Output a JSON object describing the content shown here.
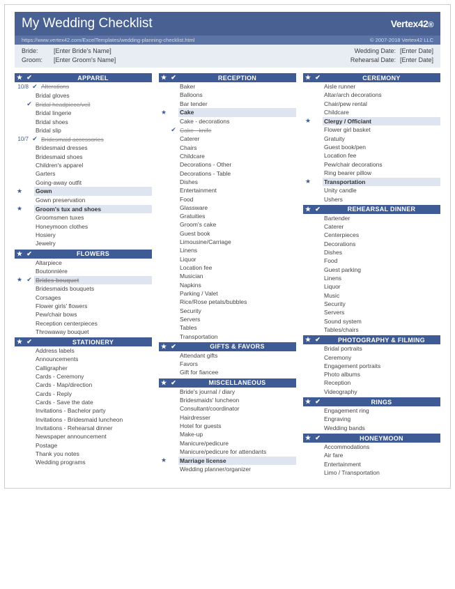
{
  "header": {
    "title": "My Wedding Checklist",
    "logo": "Vertex42",
    "url": "https://www.vertex42.com/ExcelTemplates/wedding-planning-checklist.html",
    "copyright": "© 2007-2018 Vertex42 LLC"
  },
  "info": {
    "bride_label": "Bride:",
    "bride_value": "[Enter Bride's Name]",
    "groom_label": "Groom:",
    "groom_value": "[Enter Groom's Name]",
    "wedding_label": "Wedding Date:",
    "wedding_value": "[Enter Date]",
    "rehearsal_label": "Rehearsal Date:",
    "rehearsal_value": "[Enter Date]"
  },
  "columns": [
    {
      "sections": [
        {
          "title": "APPAREL",
          "items": [
            {
              "label": "Alterations",
              "date": "10/8",
              "checked": true
            },
            {
              "label": "Bridal gloves"
            },
            {
              "label": "Bridal headpiece/veil",
              "checked": true
            },
            {
              "label": "Bridal lingerie"
            },
            {
              "label": "Bridal shoes"
            },
            {
              "label": "Bridal slip"
            },
            {
              "label": "Bridesmaid accessories",
              "date": "10/7",
              "checked": true
            },
            {
              "label": "Bridesmaid dresses"
            },
            {
              "label": "Bridesmaid shoes"
            },
            {
              "label": "Children's apparel"
            },
            {
              "label": "Garters"
            },
            {
              "label": "Going-away outfit"
            },
            {
              "label": "Gown",
              "starred": true
            },
            {
              "label": "Gown preservation"
            },
            {
              "label": "Groom's tux and shoes",
              "starred": true
            },
            {
              "label": "Groomsmen tuxes"
            },
            {
              "label": "Honeymoon clothes"
            },
            {
              "label": "Hosiery"
            },
            {
              "label": "Jewelry"
            }
          ]
        },
        {
          "title": "FLOWERS",
          "items": [
            {
              "label": "Altarpiece"
            },
            {
              "label": "Boutonnière"
            },
            {
              "label": "Brides bouquet",
              "starred": true,
              "checked": true
            },
            {
              "label": "Bridesmaids bouquets"
            },
            {
              "label": "Corsages"
            },
            {
              "label": "Flower girls' flowers"
            },
            {
              "label": "Pew/chair bows"
            },
            {
              "label": "Reception centerpieces"
            },
            {
              "label": "Throwaway bouquet"
            }
          ]
        },
        {
          "title": "STATIONERY",
          "items": [
            {
              "label": "Address labels"
            },
            {
              "label": "Announcements"
            },
            {
              "label": "Calligrapher"
            },
            {
              "label": "Cards - Ceremony"
            },
            {
              "label": "Cards - Map/direction"
            },
            {
              "label": "Cards - Reply"
            },
            {
              "label": "Cards - Save the date"
            },
            {
              "label": "Invitations - Bachelor party"
            },
            {
              "label": "Invitations - Bridesmaid luncheon"
            },
            {
              "label": "Invitations - Rehearsal dinner"
            },
            {
              "label": "Newspaper announcement"
            },
            {
              "label": "Postage"
            },
            {
              "label": "Thank you notes"
            },
            {
              "label": "Wedding programs"
            }
          ]
        }
      ]
    },
    {
      "sections": [
        {
          "title": "RECEPTION",
          "items": [
            {
              "label": "Baker"
            },
            {
              "label": "Balloons"
            },
            {
              "label": "Bar tender"
            },
            {
              "label": "Cake",
              "starred": true
            },
            {
              "label": "Cake - decorations"
            },
            {
              "label": "Cake - knife",
              "checked": true
            },
            {
              "label": "Caterer"
            },
            {
              "label": "Chairs"
            },
            {
              "label": "Childcare"
            },
            {
              "label": "Decorations - Other"
            },
            {
              "label": "Decorations - Table"
            },
            {
              "label": "Dishes"
            },
            {
              "label": "Entertainment"
            },
            {
              "label": "Food"
            },
            {
              "label": "Glassware"
            },
            {
              "label": "Gratuities"
            },
            {
              "label": "Groom's cake"
            },
            {
              "label": "Guest book"
            },
            {
              "label": "Limousine/Carriage"
            },
            {
              "label": "Linens"
            },
            {
              "label": "Liquor"
            },
            {
              "label": "Location fee"
            },
            {
              "label": "Musician"
            },
            {
              "label": "Napkins"
            },
            {
              "label": "Parking / Valet"
            },
            {
              "label": "Rice/Rose petals/bubbles"
            },
            {
              "label": "Security"
            },
            {
              "label": "Servers"
            },
            {
              "label": "Tables"
            },
            {
              "label": "Transportation"
            }
          ]
        },
        {
          "title": "GIFTS & FAVORS",
          "items": [
            {
              "label": "Attendant gifts"
            },
            {
              "label": "Favors"
            },
            {
              "label": "Gift for fiancee"
            }
          ]
        },
        {
          "title": "MISCELLANEOUS",
          "items": [
            {
              "label": "Bride's journal / diary"
            },
            {
              "label": "Bridesmaids' luncheon"
            },
            {
              "label": "Consultant/coordinator"
            },
            {
              "label": "Hairdresser"
            },
            {
              "label": "Hotel for guests"
            },
            {
              "label": "Make-up"
            },
            {
              "label": "Manicure/pedicure"
            },
            {
              "label": "Manicure/pedicure for attendants"
            },
            {
              "label": "Marriage license",
              "starred": true
            },
            {
              "label": "Wedding planner/organizer"
            }
          ]
        }
      ]
    },
    {
      "sections": [
        {
          "title": "CEREMONY",
          "items": [
            {
              "label": "Aisle runner"
            },
            {
              "label": "Altar/arch decorations"
            },
            {
              "label": "Chair/pew rental"
            },
            {
              "label": "Childcare"
            },
            {
              "label": "Clergy / Officiant",
              "starred": true
            },
            {
              "label": "Flower girl basket"
            },
            {
              "label": "Gratuity"
            },
            {
              "label": "Guest book/pen"
            },
            {
              "label": "Location fee"
            },
            {
              "label": "Pew/chair decorations"
            },
            {
              "label": "Ring bearer pillow"
            },
            {
              "label": "Transportation",
              "starred": true
            },
            {
              "label": "Unity candle"
            },
            {
              "label": "Ushers"
            }
          ]
        },
        {
          "title": "REHEARSAL DINNER",
          "items": [
            {
              "label": "Bartender"
            },
            {
              "label": "Caterer"
            },
            {
              "label": "Centerpieces"
            },
            {
              "label": "Decorations"
            },
            {
              "label": "Dishes"
            },
            {
              "label": "Food"
            },
            {
              "label": "Guest parking"
            },
            {
              "label": "Linens"
            },
            {
              "label": "Liquor"
            },
            {
              "label": "Music"
            },
            {
              "label": "Security"
            },
            {
              "label": "Servers"
            },
            {
              "label": "Sound system"
            },
            {
              "label": "Tables/chairs"
            }
          ]
        },
        {
          "title": "PHOTOGRAPHY & FILMING",
          "items": [
            {
              "label": "Bridal portraits"
            },
            {
              "label": "Ceremony"
            },
            {
              "label": "Engagement portraits"
            },
            {
              "label": "Photo albums"
            },
            {
              "label": "Reception"
            },
            {
              "label": "Videography"
            }
          ]
        },
        {
          "title": "RINGS",
          "items": [
            {
              "label": "Engagement ring"
            },
            {
              "label": "Engraving"
            },
            {
              "label": "Wedding bands"
            }
          ]
        },
        {
          "title": "HONEYMOON",
          "items": [
            {
              "label": "Accommodations"
            },
            {
              "label": "Air fare"
            },
            {
              "label": "Entertainment"
            },
            {
              "label": "Limo / Transportation"
            }
          ]
        }
      ]
    }
  ]
}
